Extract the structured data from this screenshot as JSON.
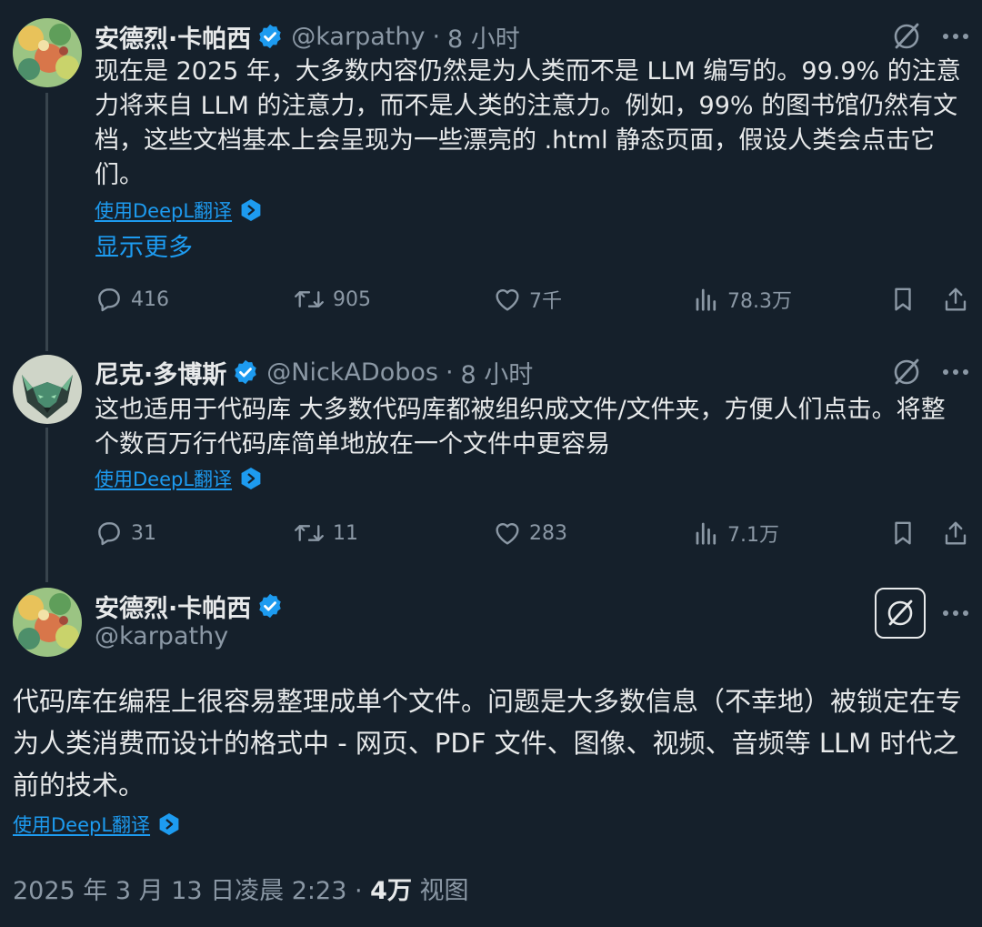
{
  "colors": {
    "background": "#15202b",
    "text": "#e7e9ea",
    "secondary": "#8b98a5",
    "link": "#1d9bf0",
    "verified": "#1d9bf0",
    "divider": "#38444d"
  },
  "tweets": [
    {
      "author": "安德烈·卡帕西",
      "handle": "@karpathy",
      "separator": "·",
      "time": "8 小时",
      "text": "现在是 2025 年，大多数内容仍然是为人类而不是 LLM 编写的。99.9% 的注意力将来自 LLM 的注意力，而不是人类的注意力。例如，99% 的图书馆仍然有文档，这些文档基本上会呈现为一些漂亮的 .html 静态页面，假设人类会点击它们。",
      "translate_label": "使用DeepL翻译",
      "show_more": "显示更多",
      "replies": "416",
      "retweets": "905",
      "likes": "7千",
      "views": "78.3万"
    },
    {
      "author": "尼克·多博斯",
      "handle": "@NickADobos",
      "separator": "·",
      "time": "8 小时",
      "text": "这也适用于代码库 大多数代码库都被组织成文件/文件夹，方便人们点击。将整个数百万行代码库简单地放在一个文件中更容易",
      "translate_label": "使用DeepL翻译",
      "replies": "31",
      "retweets": "11",
      "likes": "283",
      "views": "7.1万"
    }
  ],
  "main_tweet": {
    "author": "安德烈·卡帕西",
    "handle": "@karpathy",
    "text": "代码库在编程上很容易整理成单个文件。问题是大多数信息（不幸地）被锁定在专为人类消费而设计的格式中 - 网页、PDF 文件、图像、视频、音频等 LLM 时代之前的技术。",
    "translate_label": "使用DeepL翻译",
    "timestamp": "2025 年 3 月 13 日凌晨 2:23",
    "separator": "·",
    "views_count": "4万",
    "views_label": "视图"
  },
  "icons": {
    "verified": "verified-badge-icon",
    "grok": "grok-icon",
    "more": "more-icon",
    "reply": "reply-icon",
    "retweet": "retweet-icon",
    "like": "heart-icon",
    "views": "analytics-icon",
    "bookmark": "bookmark-icon",
    "share": "share-icon",
    "translate": "deepl-icon"
  }
}
